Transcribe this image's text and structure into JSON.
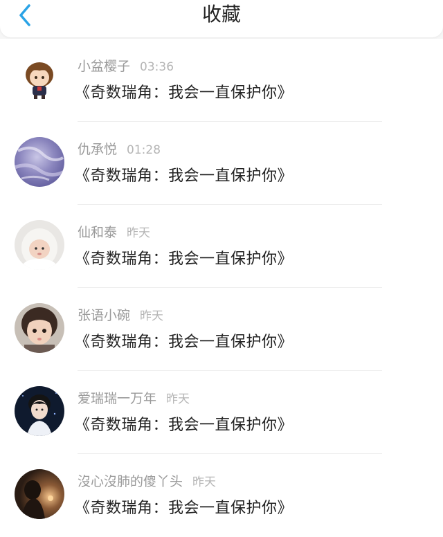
{
  "header": {
    "title": "收藏",
    "back_icon": "chevron-left-icon",
    "accent_color": "#2aa3e6"
  },
  "items": [
    {
      "name": "小盆樱子",
      "time": "03:36",
      "message": "《奇数瑞角：我会一直保护你》"
    },
    {
      "name": "仇承悦",
      "time": "01:28",
      "message": "《奇数瑞角：我会一直保护你》"
    },
    {
      "name": "仙和泰",
      "time": "昨天",
      "message": "《奇数瑞角：我会一直保护你》"
    },
    {
      "name": "张语小碗",
      "time": "昨天",
      "message": "《奇数瑞角：我会一直保护你》"
    },
    {
      "name": "爱瑞瑞一万年",
      "time": "昨天",
      "message": "《奇数瑞角：我会一直保护你》"
    },
    {
      "name": "沒心沒肺的傻丫头",
      "time": "昨天",
      "message": "《奇数瑞角：我会一直保护你》"
    }
  ]
}
